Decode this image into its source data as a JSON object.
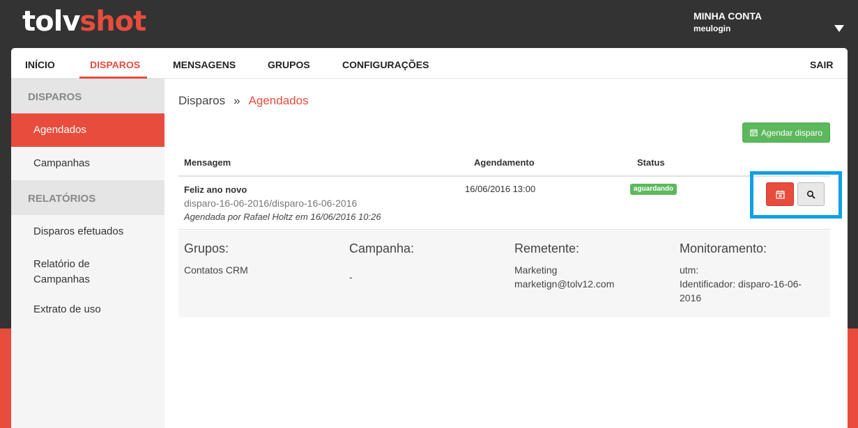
{
  "brand": {
    "part1": "tolv",
    "part2": "shot"
  },
  "account": {
    "title": "MINHA CONTA",
    "login": "meulogin"
  },
  "nav": {
    "items": [
      "INÍCIO",
      "DISPAROS",
      "MENSAGENS",
      "GRUPOS",
      "CONFIGURAÇÕES"
    ],
    "logout": "SAIR"
  },
  "sidebar": {
    "section1": "DISPAROS",
    "item_agendados": "Agendados",
    "item_campanhas": "Campanhas",
    "section2": "RELATÓRIOS",
    "item_disparos_efetuados": "Disparos efetuados",
    "item_relatorio_campanhas": "Relatório de Campanhas",
    "item_extrato": "Extrato de uso"
  },
  "breadcrumb": {
    "root": "Disparos",
    "sep": "»",
    "current": "Agendados"
  },
  "schedule_button": "Agendar disparo",
  "table": {
    "headers": {
      "mensagem": "Mensagem",
      "agendamento": "Agendamento",
      "status": "Status"
    },
    "row": {
      "title": "Feliz ano novo",
      "id": "disparo-16-06-2016/disparo-16-06-2016",
      "by": "Agendada por Rafael Holtz em 16/06/2016 10:26",
      "schedule": "16/06/2016 13:00",
      "status": "aguardando"
    }
  },
  "details": {
    "grupos_title": "Grupos:",
    "grupos_value": "Contatos CRM",
    "campanha_title": "Campanha:",
    "campanha_value": "-",
    "remetente_title": "Remetente:",
    "remetente_name": "Marketing",
    "remetente_email": "marketign@tolv12.com",
    "monitoramento_title": "Monitoramento:",
    "monitoramento_utm": "utm:",
    "monitoramento_id": "Identificador: disparo-16-06-2016"
  },
  "colors": {
    "accent": "#e74c3c",
    "success": "#5cb85c",
    "highlight": "#0aa1e5",
    "topbar": "#333333"
  },
  "icons": {
    "schedule_button": "calendar-icon",
    "cancel_button": "calendar-cancel-icon",
    "view_button": "magnifier-icon",
    "account": "caret-down-icon"
  }
}
